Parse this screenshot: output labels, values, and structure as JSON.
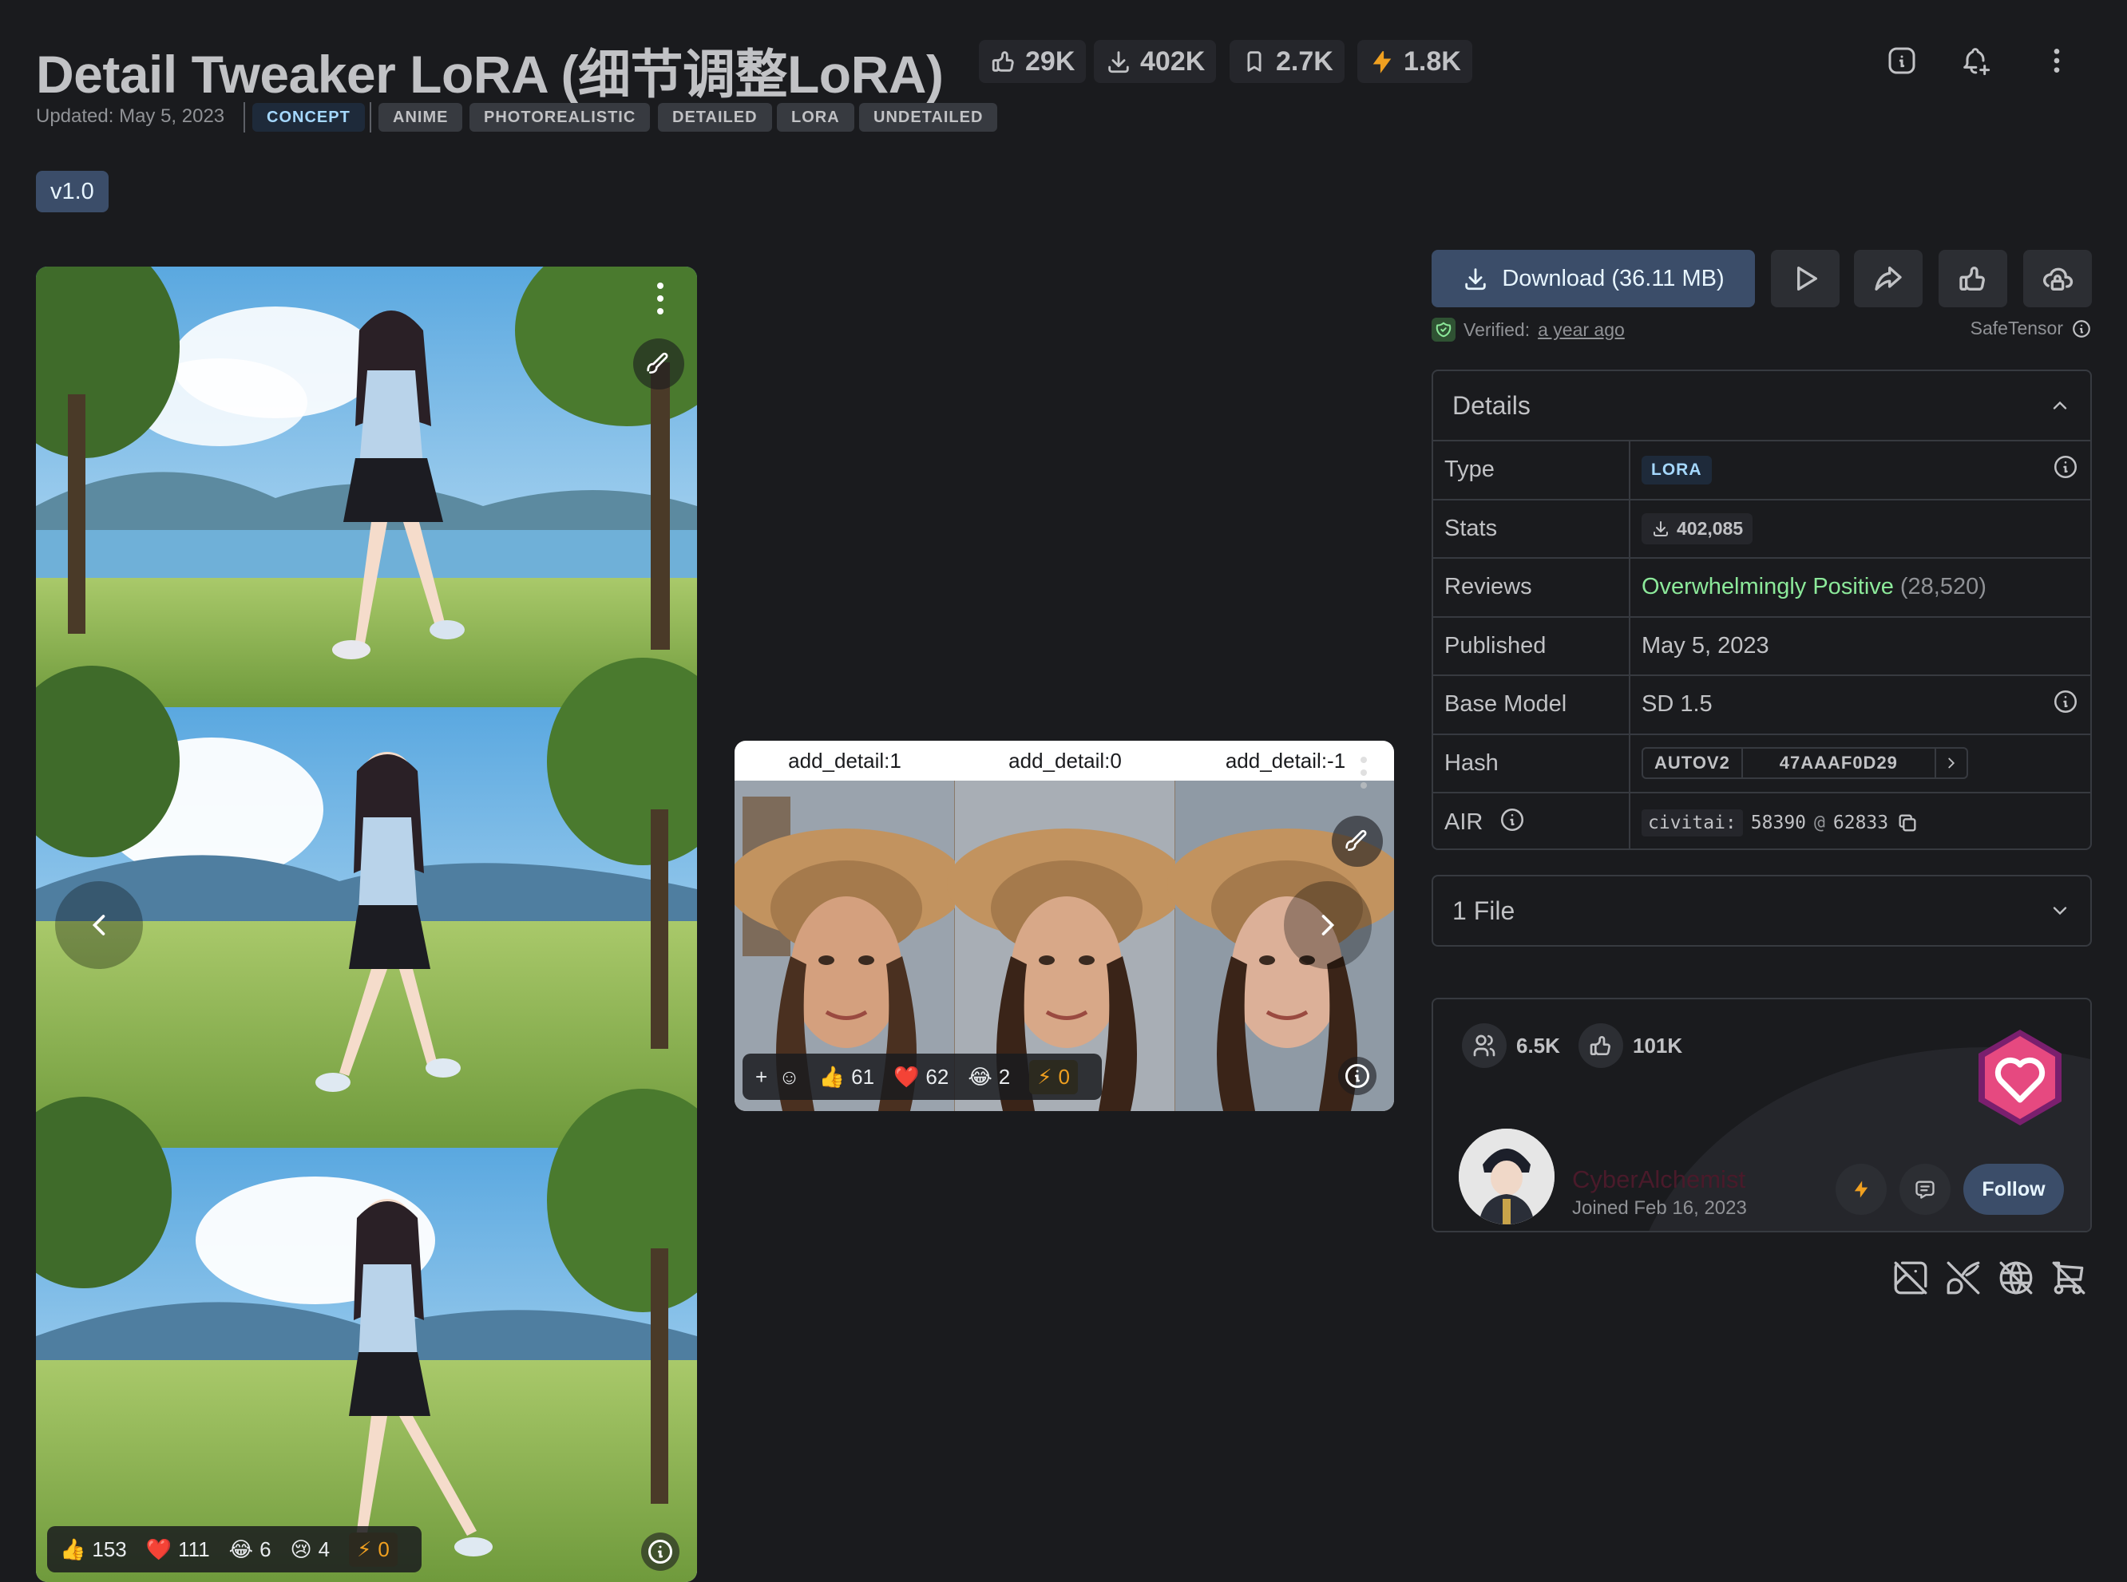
{
  "header": {
    "title": "Detail Tweaker LoRA (细节调整LoRA)",
    "stats": [
      {
        "icon": "thumbs-up-icon",
        "value": "29K"
      },
      {
        "icon": "download-icon",
        "value": "402K"
      },
      {
        "icon": "bookmark-icon",
        "value": "2.7K"
      },
      {
        "icon": "bolt-icon",
        "value": "1.8K"
      }
    ],
    "updated": "Updated: May 5, 2023",
    "tags": [
      "CONCEPT",
      "ANIME",
      "PHOTOREALISTIC",
      "DETAILED",
      "LORA",
      "UNDETAILED"
    ],
    "version": "v1.0"
  },
  "left_image": {
    "reactions": {
      "like": "153",
      "heart": "111",
      "laugh": "6",
      "cry": "4",
      "bolt": "0"
    }
  },
  "mid_image": {
    "columns": [
      "add_detail:1",
      "add_detail:0",
      "add_detail:-1"
    ],
    "reactions": {
      "like": "61",
      "heart": "62",
      "laugh": "2",
      "bolt": "0"
    }
  },
  "actions": {
    "download_label": "Download (36.11 MB)",
    "verified_label": "Verified:",
    "verified_time": "a year ago",
    "safetensor": "SafeTensor"
  },
  "details": {
    "title": "Details",
    "type_label": "Type",
    "type_value": "LORA",
    "stats_label": "Stats",
    "stats_value": "402,085",
    "reviews_label": "Reviews",
    "reviews_value": "Overwhelmingly Positive",
    "reviews_count": "(28,520)",
    "published_label": "Published",
    "published_value": "May 5, 2023",
    "base_label": "Base Model",
    "base_value": "SD 1.5",
    "hash_label": "Hash",
    "hash_type": "AUTOV2",
    "hash_value": "47AAAF0D29",
    "air_label": "AIR",
    "air_prefix": "civitai:",
    "air_model": "58390",
    "air_at": "@",
    "air_version": "62833"
  },
  "files": {
    "label": "1 File"
  },
  "creator": {
    "followers": "6.5K",
    "likes": "101K",
    "name": "CyberAlchemist",
    "joined": "Joined Feb 16, 2023",
    "follow_label": "Follow"
  },
  "colors": {
    "background": "#1a1b1e",
    "accent": "#3b4d69",
    "positive": "#8ce99a",
    "badge_pink": "#e64980"
  }
}
